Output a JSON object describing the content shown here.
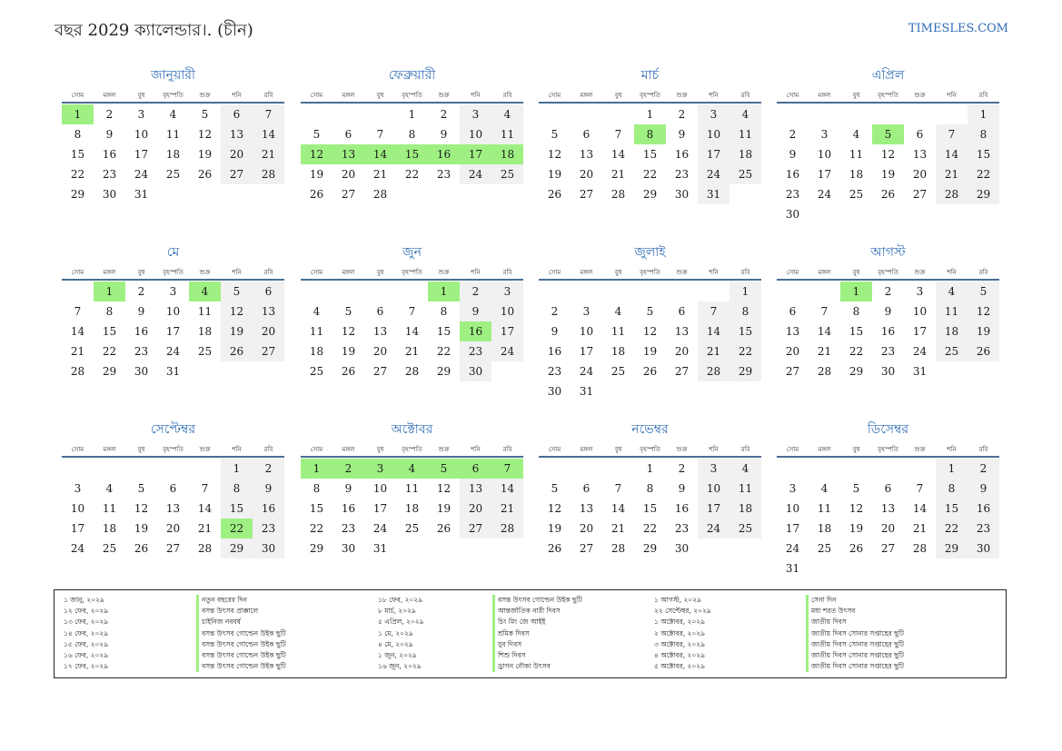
{
  "header": {
    "title": "বছর 2029 ক্যালেন্ডার।. (চীন)",
    "site": "TIMESLES.COM"
  },
  "weekdays": [
    "সোম",
    "মঙ্গল",
    "বুধ",
    "বৃহস্পতি",
    "শুক্র",
    "শনি",
    "রবি"
  ],
  "colors": {
    "accent": "#2f6db5",
    "holiday": "#9ff082",
    "weekend": "#f1f1f1",
    "rule": "#4a6f93"
  },
  "months": [
    {
      "name": "জানুয়ারী",
      "offset": 0,
      "days": 31,
      "holidays": [
        1
      ]
    },
    {
      "name": "ফেব্রুয়ারী",
      "offset": 3,
      "days": 28,
      "holidays": [
        12,
        13,
        14,
        15,
        16,
        17,
        18
      ]
    },
    {
      "name": "মার্চ",
      "offset": 3,
      "days": 31,
      "holidays": [
        8
      ]
    },
    {
      "name": "এপ্রিল",
      "offset": 6,
      "days": 30,
      "holidays": [
        5
      ]
    },
    {
      "name": "মে",
      "offset": 1,
      "days": 31,
      "holidays": [
        1,
        4
      ]
    },
    {
      "name": "জুন",
      "offset": 4,
      "days": 30,
      "holidays": [
        1,
        16
      ]
    },
    {
      "name": "জুলাই",
      "offset": 6,
      "days": 31,
      "holidays": []
    },
    {
      "name": "আগস্ট",
      "offset": 2,
      "days": 31,
      "holidays": [
        1
      ]
    },
    {
      "name": "সেপ্টেম্বর",
      "offset": 5,
      "days": 30,
      "holidays": [
        22
      ]
    },
    {
      "name": "অক্টোবর",
      "offset": 0,
      "days": 31,
      "holidays": [
        1,
        2,
        3,
        4,
        5,
        6,
        7
      ]
    },
    {
      "name": "নভেম্বর",
      "offset": 3,
      "days": 30,
      "holidays": []
    },
    {
      "name": "ডিসেম্বর",
      "offset": 5,
      "days": 31,
      "holidays": []
    }
  ],
  "holiday_list": [
    [
      {
        "date": "১ জানু, ২০২৯",
        "name": "নতুন বছরের দিন"
      },
      {
        "date": "১২ ফেব, ২০২৯",
        "name": "বসন্ত উৎসব প্রাক্কালে"
      },
      {
        "date": "১৩ ফেব, ২০২৯",
        "name": "চাইনিজ নববর্ষ"
      },
      {
        "date": "১৪ ফেব, ২০২৯",
        "name": "বসন্ত উৎসব গোল্ডেন উইক ছুটি"
      },
      {
        "date": "১৫ ফেব, ২০২৯",
        "name": "বসন্ত উৎসব গোল্ডেন উইক ছুটি"
      },
      {
        "date": "১৬ ফেব, ২০২৯",
        "name": "বসন্ত উৎসব গোল্ডেন উইক ছুটি"
      },
      {
        "date": "১৭ ফেব, ২০২৯",
        "name": "বসন্ত উৎসব গোল্ডেন উইক ছুটি"
      }
    ],
    [
      {
        "date": "১৮ ফেব, ২০২৯",
        "name": "বসন্ত উৎসব গোল্ডেন উইক ছুটি"
      },
      {
        "date": "৮ মার্চ, ২০২৯",
        "name": "আন্তর্জাতিক নারী দিবস"
      },
      {
        "date": "৫ এপ্রিল, ২০২৯",
        "name": "চিং মিং জে আইই"
      },
      {
        "date": "১ মে, ২০২৯",
        "name": "শ্রমিক দিবস"
      },
      {
        "date": "৪ মে, ২০২৯",
        "name": "যুব দিবস"
      },
      {
        "date": "১ জুন, ২০২৯",
        "name": "শিশু দিবস"
      },
      {
        "date": "১৬ জুন, ২০২৯",
        "name": "ড্রাগন নৌকা উৎসব"
      }
    ],
    [
      {
        "date": "১ আগস্ট, ২০২৯",
        "name": "সেনা দিন"
      },
      {
        "date": "২২ সেপ্টেম্বর, ২০২৯",
        "name": "মধ্য শরত উৎসব"
      },
      {
        "date": "১ অক্টোবর, ২০২৯",
        "name": "জাতীয় দিবস"
      },
      {
        "date": "২ অক্টোবর, ২০২৯",
        "name": "জাতীয় দিবস সোনার সপ্তাহের ছুটি"
      },
      {
        "date": "৩ অক্টোবর, ২০২৯",
        "name": "জাতীয় দিবস সোনার সপ্তাহের ছুটি"
      },
      {
        "date": "৪ অক্টোবর, ২০২৯",
        "name": "জাতীয় দিবস সোনার সপ্তাহের ছুটি"
      },
      {
        "date": "৫ অক্টোবর, ২০২৯",
        "name": "জাতীয় দিবস সোনার সপ্তাহের ছুটি"
      }
    ]
  ]
}
